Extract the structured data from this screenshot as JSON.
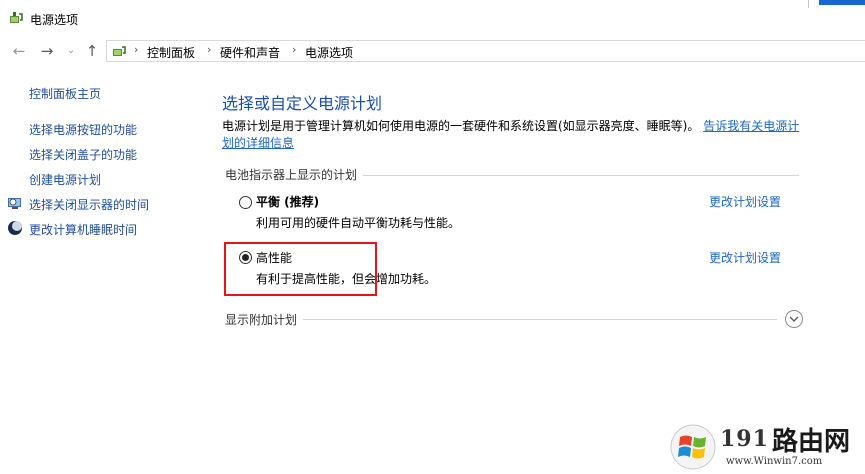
{
  "window": {
    "title": "电源选项"
  },
  "nav": {
    "back_icon": "arrow-left-icon",
    "forward_icon": "arrow-right-icon",
    "recent_icon": "chevron-down-icon",
    "up_icon": "arrow-up-icon",
    "breadcrumbs": [
      "控制面板",
      "硬件和声音",
      "电源选项"
    ]
  },
  "sidebar": {
    "home": "控制面板主页",
    "items": [
      {
        "label": "选择电源按钮的功能"
      },
      {
        "label": "选择关闭盖子的功能"
      },
      {
        "label": "创建电源计划"
      },
      {
        "label": "选择关闭显示器的时间",
        "icon": "monitor-clock-icon"
      },
      {
        "label": "更改计算机睡眠时间",
        "icon": "moon-icon"
      }
    ]
  },
  "main": {
    "title": "选择或自定义电源计划",
    "description": "电源计划是用于管理计算机如何使用电源的一套硬件和系统设置(如显示器亮度、睡眠等)。",
    "description_link": "告诉我有关电源计划的详细信息",
    "section_heading": "电池指示器上显示的计划",
    "plans": [
      {
        "name": "平衡 (推荐)",
        "description": "利用可用的硬件自动平衡功耗与性能。",
        "selected": false,
        "link": "更改计划设置"
      },
      {
        "name": "高性能",
        "description": "有利于提高性能，但会增加功耗。",
        "selected": true,
        "link": "更改计划设置"
      }
    ],
    "more_plans": "显示附加计划"
  },
  "watermark": {
    "number": "191",
    "name": "路由网",
    "url": "www.Winwin7.com"
  },
  "colors": {
    "link": "#1f66c2",
    "title_blue": "#1b4fa8",
    "highlight": "#e8141b"
  }
}
